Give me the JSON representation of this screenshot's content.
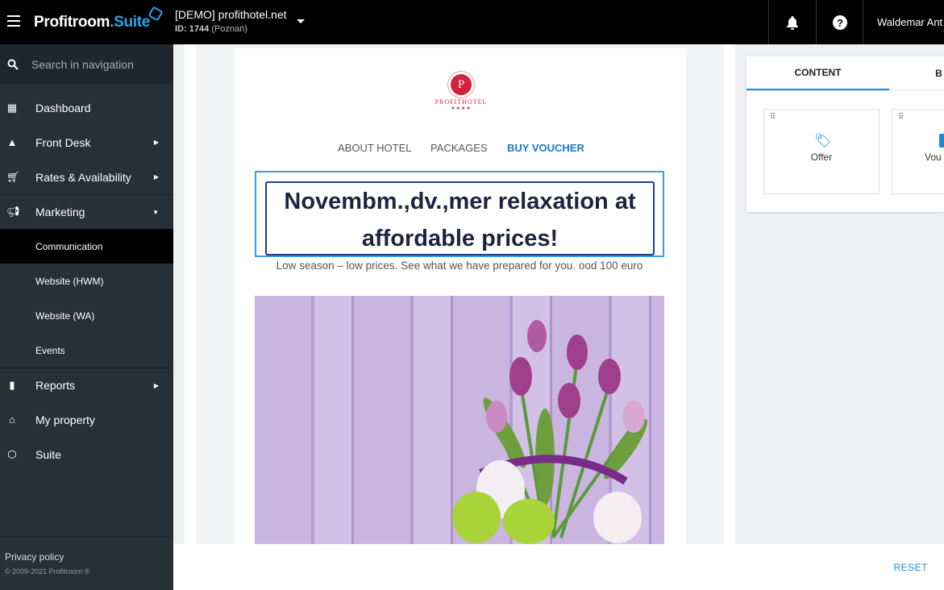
{
  "header": {
    "brand_main": "Profitroom",
    "brand_suffix": "Suite",
    "hotel_name": "[DEMO] profithotel.net",
    "hotel_id_label": "ID: 1744",
    "hotel_city": "(Poznań)",
    "user_name": "Waldemar Ant"
  },
  "sidebar": {
    "search_placeholder": "Search in navigation",
    "items": [
      {
        "label": "Dashboard"
      },
      {
        "label": "Front Desk"
      },
      {
        "label": "Rates & Availability"
      },
      {
        "label": "Marketing"
      }
    ],
    "marketing_sub": [
      {
        "label": "Communication"
      },
      {
        "label": "Website (HWM)"
      },
      {
        "label": "Website (WA)"
      },
      {
        "label": "Events"
      }
    ],
    "items2": [
      {
        "label": "Reports"
      },
      {
        "label": "My property"
      },
      {
        "label": "Suite"
      }
    ],
    "privacy": "Privacy policy",
    "copyright": "© 2009-2021 Profitroom ®"
  },
  "email": {
    "logo_text": "PROFITHOTEL",
    "logo_stars": "★★★★",
    "logo_letter": "P",
    "menu": [
      "ABOUT HOTEL",
      "PACKAGES",
      "BUY VOUCHER"
    ],
    "headline": "Novembm.,dv.,mer relaxation at affordable prices!",
    "subtitle": "Low season – low prices. See what we have prepared for you. ood 100 euro"
  },
  "panel": {
    "tabs": [
      "CONTENT",
      "B"
    ],
    "cards": [
      {
        "label": "Offer"
      },
      {
        "label": "Vou"
      }
    ]
  },
  "footer": {
    "reset": "RESET"
  }
}
